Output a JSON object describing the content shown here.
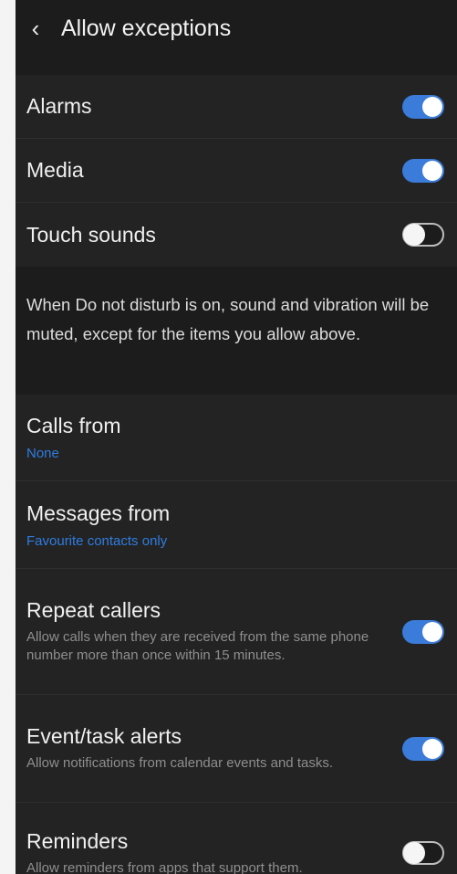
{
  "header": {
    "title": "Allow exceptions"
  },
  "toggles": [
    {
      "label": "Alarms",
      "state": "on"
    },
    {
      "label": "Media",
      "state": "on"
    },
    {
      "label": "Touch sounds",
      "state": "off"
    }
  ],
  "info_text": "When Do not disturb is on, sound and vibration will be muted, except for the items you allow above.",
  "calls": {
    "label": "Calls from",
    "value": "None"
  },
  "messages": {
    "label": "Messages from",
    "value": "Favourite contacts only"
  },
  "repeat_callers": {
    "label": "Repeat callers",
    "description": "Allow calls when they are received from the same phone number more than once within 15 minutes.",
    "state": "on"
  },
  "event_alerts": {
    "label": "Event/task alerts",
    "description": "Allow notifications from calendar events and tasks.",
    "state": "on"
  },
  "reminders": {
    "label": "Reminders",
    "description": "Allow reminders from apps that support them.",
    "state": "off"
  },
  "colors": {
    "accent": "#3b7bd9",
    "link": "#2f7de1",
    "background": "#1c1c1c",
    "card": "#232323"
  }
}
